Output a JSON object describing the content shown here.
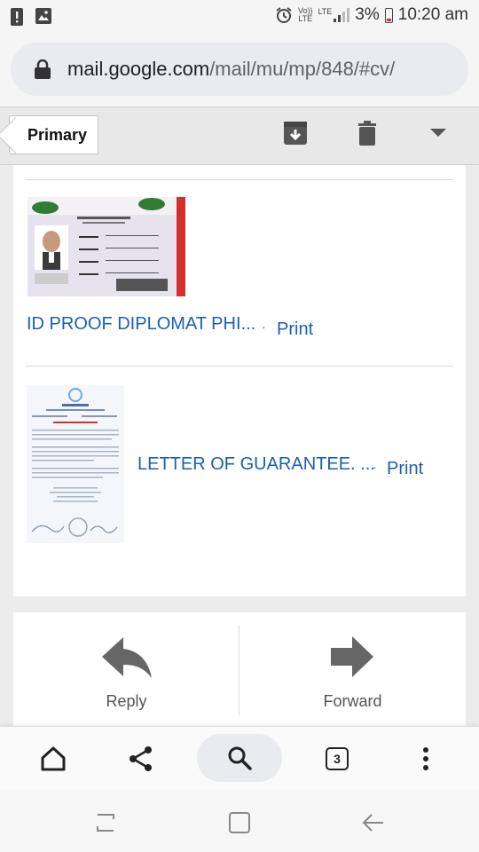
{
  "status_bar": {
    "volte_top": "Vo))",
    "volte_bottom": "LTE",
    "network": "LTE",
    "battery": "3%",
    "time": "10:20 am"
  },
  "url_bar": {
    "host": "mail.google.com",
    "path": "/mail/mu/mp/848/#cv/"
  },
  "toolbar": {
    "back_label": "Primary",
    "icons": [
      "archive-icon",
      "delete-icon",
      "dropdown-icon"
    ]
  },
  "attachments": [
    {
      "name": "ID PROOF DIPLOMAT PHI...",
      "print_label": "Print",
      "thumb": "id-card-image"
    },
    {
      "name": "LETTER OF GUARANTEE. ...",
      "print_label": "Print",
      "thumb": "letter-document-image"
    }
  ],
  "actions": {
    "reply_label": "Reply",
    "forward_label": "Forward"
  },
  "browser_bar": {
    "tab_count": "3",
    "icons": [
      "home-icon",
      "share-icon",
      "search-icon",
      "tabs-icon",
      "more-icon"
    ]
  },
  "nav_bar": {
    "icons": [
      "recent-apps-icon",
      "home-button-icon",
      "back-icon"
    ]
  },
  "colors": {
    "link": "#1a5fb4",
    "page_bg": "#ececec"
  }
}
